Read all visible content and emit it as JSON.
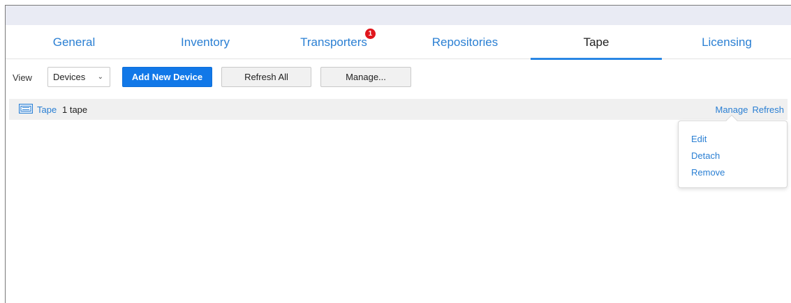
{
  "tabs": [
    {
      "label": "General",
      "active": false
    },
    {
      "label": "Inventory",
      "active": false
    },
    {
      "label": "Transporters",
      "active": false,
      "badge": "1"
    },
    {
      "label": "Repositories",
      "active": false
    },
    {
      "label": "Tape",
      "active": true
    },
    {
      "label": "Licensing",
      "active": false
    }
  ],
  "toolbar": {
    "view_label": "View",
    "view_selected": "Devices",
    "add_button": "Add New Device",
    "refresh_button": "Refresh All",
    "manage_button": "Manage..."
  },
  "device_row": {
    "icon": "tape-drive-icon",
    "name": "Tape",
    "count": "1 tape",
    "manage_link": "Manage",
    "refresh_link": "Refresh"
  },
  "manage_menu": {
    "items": [
      "Edit",
      "Detach",
      "Remove"
    ]
  },
  "colors": {
    "accent": "#1178e8",
    "link": "#2a7fd3",
    "badge": "#e0161d",
    "topbar": "#e9ebf4"
  }
}
